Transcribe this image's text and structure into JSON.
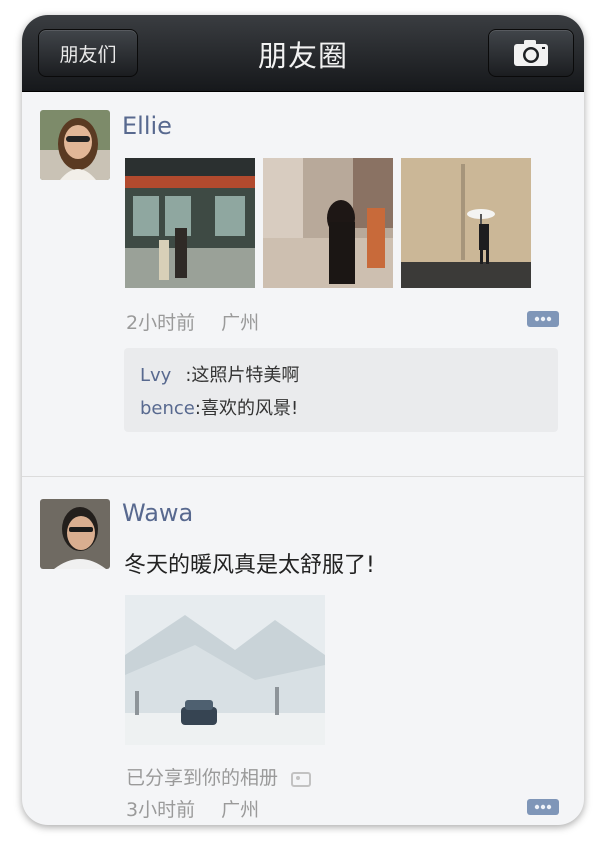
{
  "nav": {
    "back_label": "朋友们",
    "title": "朋友圈",
    "camera_icon": "camera-icon"
  },
  "posts": [
    {
      "author": "Ellie",
      "time": "2小时前",
      "location": "广州",
      "comments": [
        {
          "author": "Lvy",
          "separator": ":",
          "text": "这照片特美啊"
        },
        {
          "author": "bence",
          "separator": ":",
          "text": "喜欢的风景!"
        }
      ]
    },
    {
      "author": "Wawa",
      "text": "冬天的暖风真是太舒服了!",
      "share_text": "已分享到你的相册",
      "time": "3小时前",
      "location": "广州"
    }
  ],
  "colors": {
    "name": "#58698f",
    "meta": "#9a9a9a",
    "navbar": "#1e2023"
  }
}
